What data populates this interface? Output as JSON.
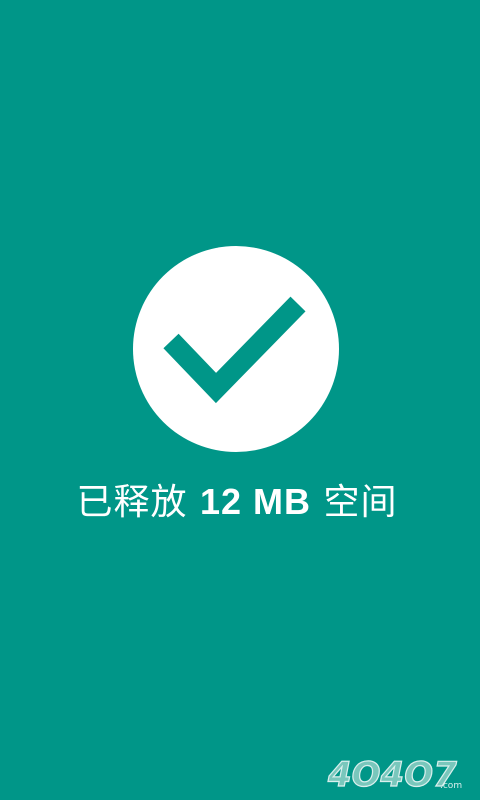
{
  "result": {
    "prefix": "已释放",
    "amount": "12 MB",
    "suffix": "空间"
  },
  "colors": {
    "background": "#009688",
    "circle": "#ffffff",
    "check": "#009688",
    "text": "#ffffff"
  },
  "icons": {
    "status": "checkmark-icon"
  },
  "watermark": {
    "logo_text": "4O4O7",
    "logo_suffix": ".com"
  }
}
